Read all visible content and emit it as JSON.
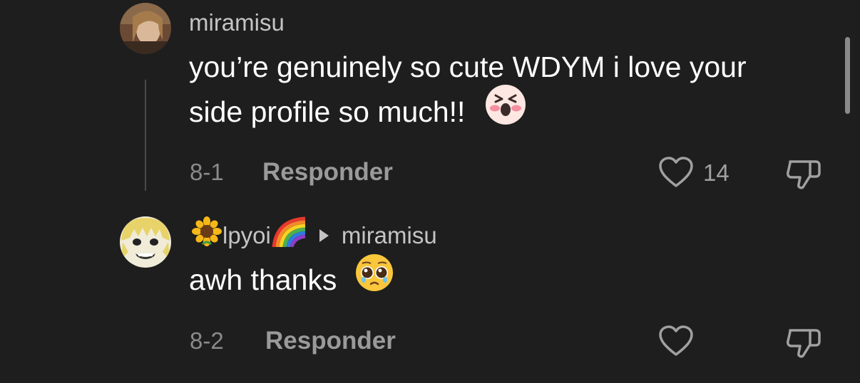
{
  "comments": [
    {
      "username": "miramisu",
      "text_line1": "you’re genuinely so cute WDYM i love your",
      "text_line2": "side profile so much!!",
      "emoji_icon": "screaming-face-emoji",
      "date": "8-1",
      "reply_label": "Responder",
      "like_count": "14"
    },
    {
      "username": "lpyoi",
      "username_prefix_icon": "sunflower-emoji",
      "username_suffix_icon": "rainbow-emoji",
      "reply_to": "miramisu",
      "text": "awh thanks",
      "emoji_icon": "pleading-face-emoji",
      "date": "8-2",
      "reply_label": "Responder"
    }
  ],
  "colors": {
    "background": "#1e1e1e",
    "text": "#ffffff",
    "muted": "#8a8a8a"
  }
}
